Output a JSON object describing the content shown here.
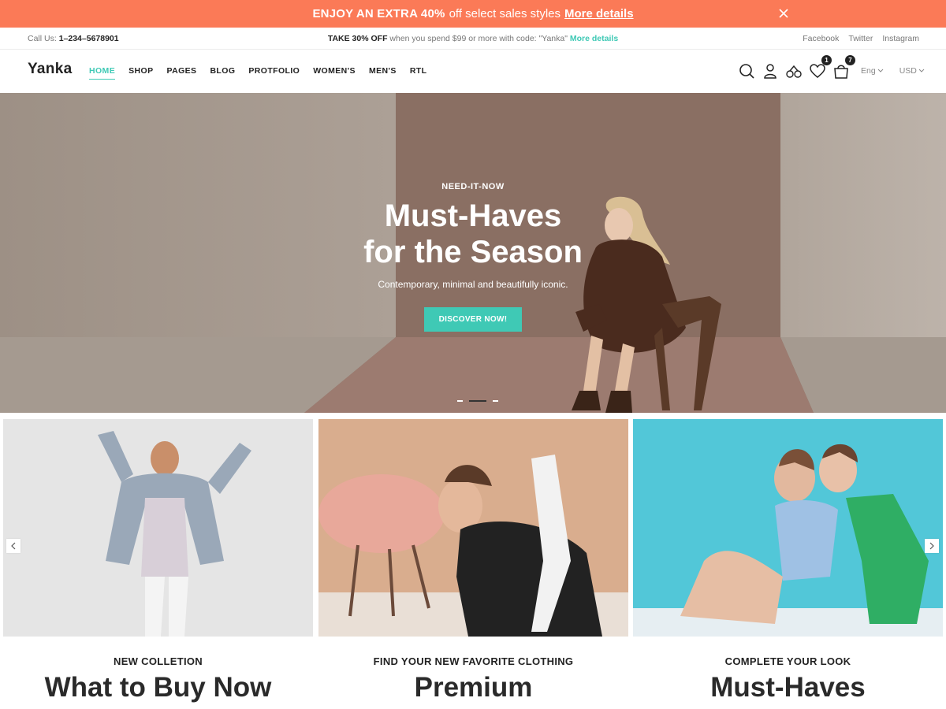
{
  "promo": {
    "strong": "ENJOY AN EXTRA 40%",
    "middle": "off select sales styles",
    "link": "More details",
    "close_icon": "close-icon"
  },
  "topbar": {
    "call_label": "Call Us:",
    "call_number": "1–234–5678901",
    "offer_bold": "TAKE 30% OFF",
    "offer_text": "when you spend $99 or more with code: \"Yanka\"",
    "offer_link": "More details",
    "social": [
      "Facebook",
      "Twitter",
      "Instagram"
    ]
  },
  "header": {
    "logo": "Yanka",
    "nav": [
      "HOME",
      "SHOP",
      "PAGES",
      "BLOG",
      "PROTFOLIO",
      "WOMEN'S",
      "MEN'S",
      "RTL"
    ],
    "active_nav": "HOME",
    "icons": [
      "search-icon",
      "user-icon",
      "compare-icon",
      "heart-icon",
      "bag-icon"
    ],
    "wishlist_count": "1",
    "cart_count": "7",
    "language": "Eng",
    "currency": "USD"
  },
  "hero": {
    "kicker": "NEED-IT-NOW",
    "title_line1": "Must-Haves",
    "title_line2": "for the Season",
    "subtitle": "Contemporary, minimal and beautifully iconic.",
    "button": "DISCOVER NOW!",
    "slides": 3,
    "active_slide": 2
  },
  "collections": [
    {
      "kicker": "NEW COLLETION",
      "title": "What to Buy Now"
    },
    {
      "kicker": "FIND YOUR NEW FAVORITE CLOTHING",
      "title": "Premium"
    },
    {
      "kicker": "COMPLETE YOUR LOOK",
      "title": "Must-Haves"
    }
  ],
  "colors": {
    "promo_bg": "#fb7a57",
    "accent_teal": "#3fc9b5",
    "text_dark": "#222222"
  }
}
